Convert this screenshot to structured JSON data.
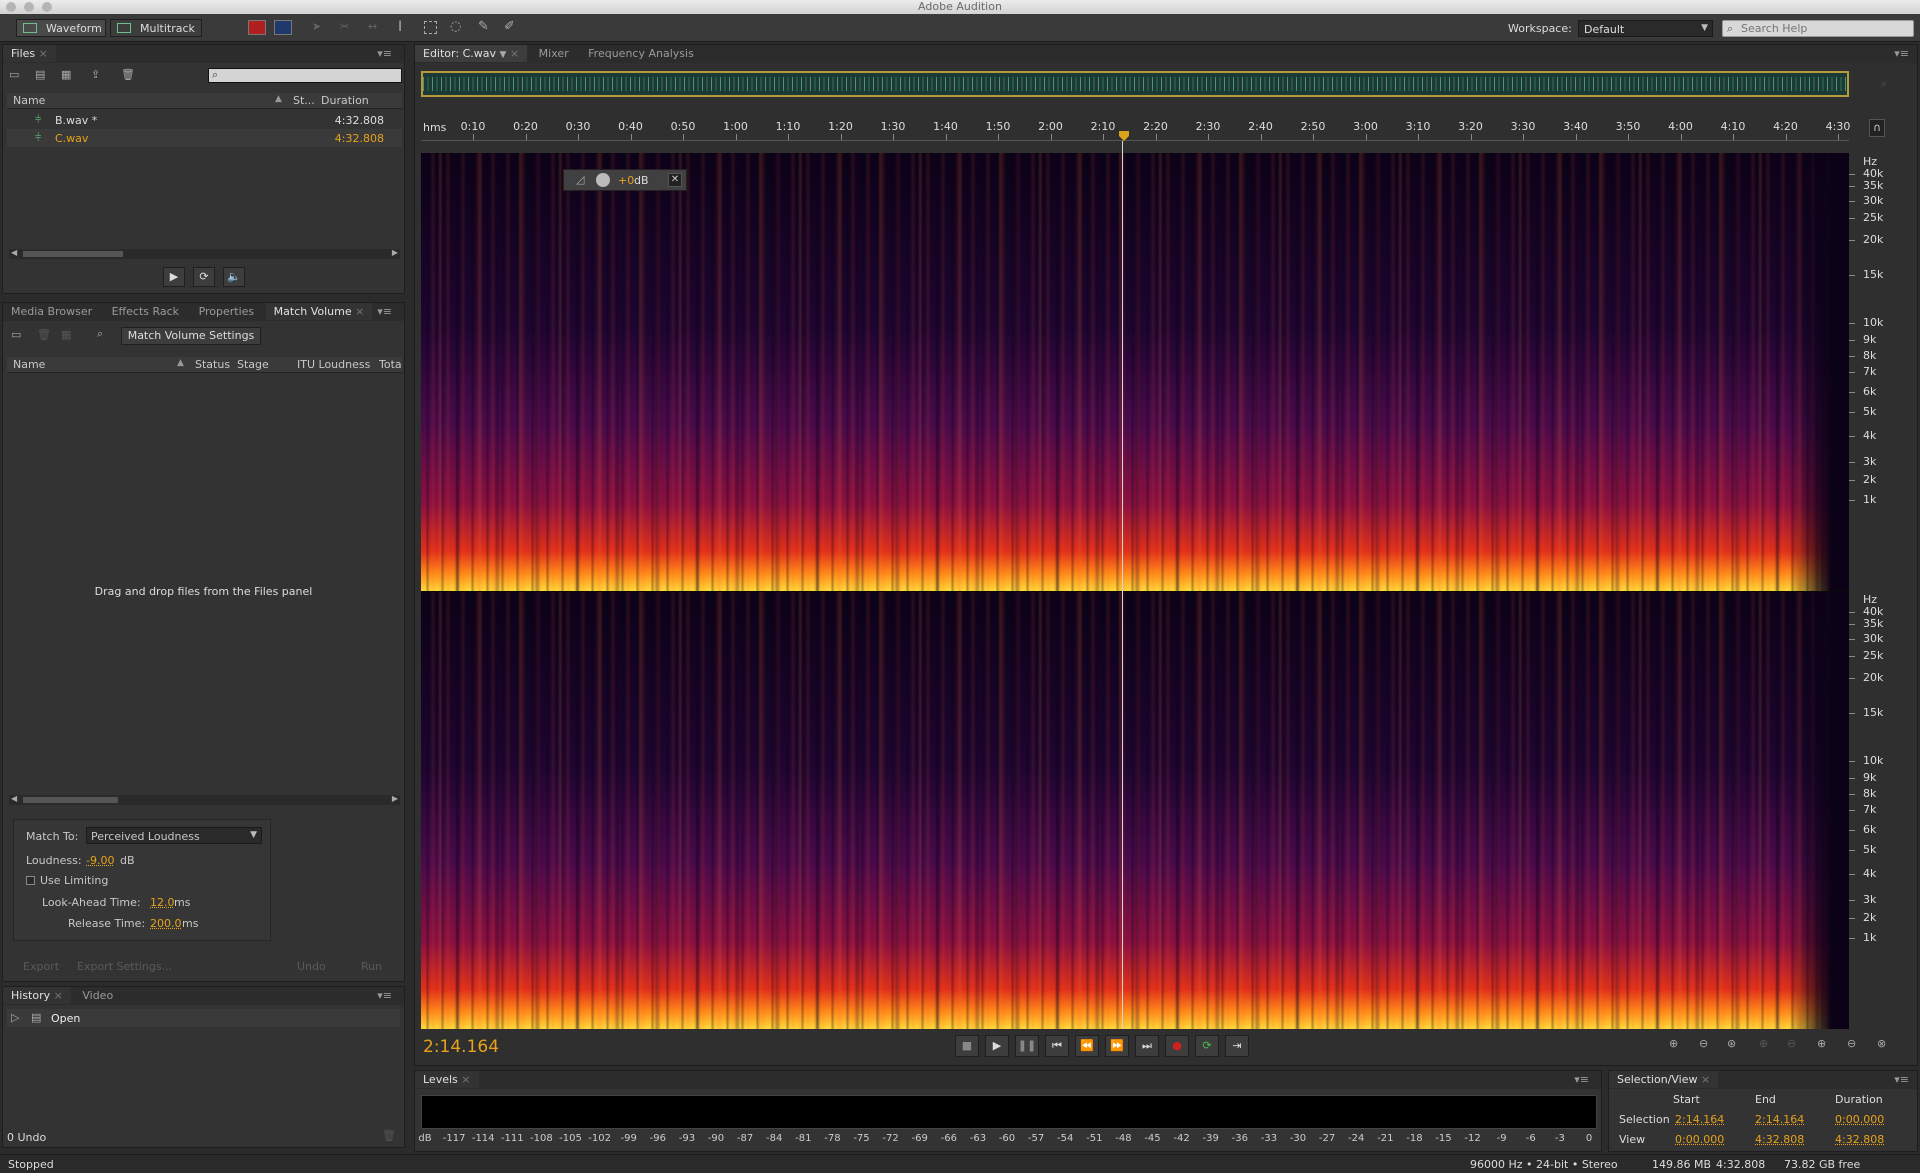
{
  "window": {
    "title": "Adobe Audition"
  },
  "toolbar": {
    "waveform_label": "Waveform",
    "multitrack_label": "Multitrack",
    "workspace_label": "Workspace:",
    "workspace_value": "Default",
    "search_placeholder": "Search Help"
  },
  "files_panel": {
    "tab": "Files",
    "columns": {
      "name": "Name",
      "status": "St...",
      "duration": "Duration"
    },
    "files": [
      {
        "name": "B.wav *",
        "duration": "4:32.808"
      },
      {
        "name": "C.wav",
        "duration": "4:32.808"
      }
    ]
  },
  "lower_tabs": [
    "Media Browser",
    "Effects Rack",
    "Properties",
    "Match Volume"
  ],
  "match_volume": {
    "settings_button": "Match Volume Settings",
    "columns": {
      "name": "Name",
      "status": "Status",
      "stage": "Stage",
      "itu": "ITU Loudness",
      "total": "Tota"
    },
    "empty_hint": "Drag and drop files from the Files panel",
    "match_to_label": "Match To:",
    "match_to_value": "Perceived Loudness",
    "loudness_label": "Loudness:",
    "loudness_value": "-9.00",
    "loudness_unit": "dB",
    "use_limiting": "Use Limiting",
    "lookahead_label": "Look-Ahead Time:",
    "lookahead_value": "12.0",
    "release_label": "Release Time:",
    "release_value": "200.0",
    "ms": "ms",
    "export_button": "Export",
    "export_settings_button": "Export Settings...",
    "undo_button": "Undo",
    "run_button": "Run"
  },
  "history_panel": {
    "tabs": [
      "History",
      "Video"
    ],
    "items": [
      "Open"
    ],
    "undo_count": "0 Undo"
  },
  "status_bar": {
    "state": "Stopped",
    "format": "96000 Hz • 24-bit • Stereo",
    "size": "149.86 MB",
    "duration": "4:32.808",
    "free": "73.82 GB free"
  },
  "editor": {
    "tabs": [
      "Editor: C.wav",
      "Mixer",
      "Frequency Analysis"
    ],
    "hud_gain": "+0",
    "hud_unit": "dB",
    "time_unit": "hms",
    "ruler_ticks": [
      "0:10",
      "0:20",
      "0:30",
      "0:40",
      "0:50",
      "1:00",
      "1:10",
      "1:20",
      "1:30",
      "1:40",
      "1:50",
      "2:00",
      "2:10",
      "2:20",
      "2:30",
      "2:40",
      "2:50",
      "3:00",
      "3:10",
      "3:20",
      "3:30",
      "3:40",
      "3:50",
      "4:00",
      "4:10",
      "4:20",
      "4:30"
    ],
    "freq_unit": "Hz",
    "freq_labels": [
      "40k",
      "35k",
      "30k",
      "25k",
      "20k",
      "15k",
      "10k",
      "9k",
      "8k",
      "7k",
      "6k",
      "5k",
      "4k",
      "3k",
      "2k",
      "1k"
    ],
    "current_time": "2:14.164"
  },
  "levels_panel": {
    "tab": "Levels",
    "scale": [
      "dB",
      "-117",
      "-114",
      "-111",
      "-108",
      "-105",
      "-102",
      "-99",
      "-96",
      "-93",
      "-90",
      "-87",
      "-84",
      "-81",
      "-78",
      "-75",
      "-72",
      "-69",
      "-66",
      "-63",
      "-60",
      "-57",
      "-54",
      "-51",
      "-48",
      "-45",
      "-42",
      "-39",
      "-36",
      "-33",
      "-30",
      "-27",
      "-24",
      "-21",
      "-18",
      "-15",
      "-12",
      "-9",
      "-6",
      "-3",
      "0"
    ]
  },
  "selection_view": {
    "tab": "Selection/View",
    "headers": {
      "start": "Start",
      "end": "End",
      "duration": "Duration"
    },
    "selection": {
      "label": "Selection",
      "start": "2:14.164",
      "end": "2:14.164",
      "duration": "0:00.000"
    },
    "view": {
      "label": "View",
      "start": "0:00.000",
      "end": "4:32.808",
      "duration": "4:32.808"
    }
  }
}
